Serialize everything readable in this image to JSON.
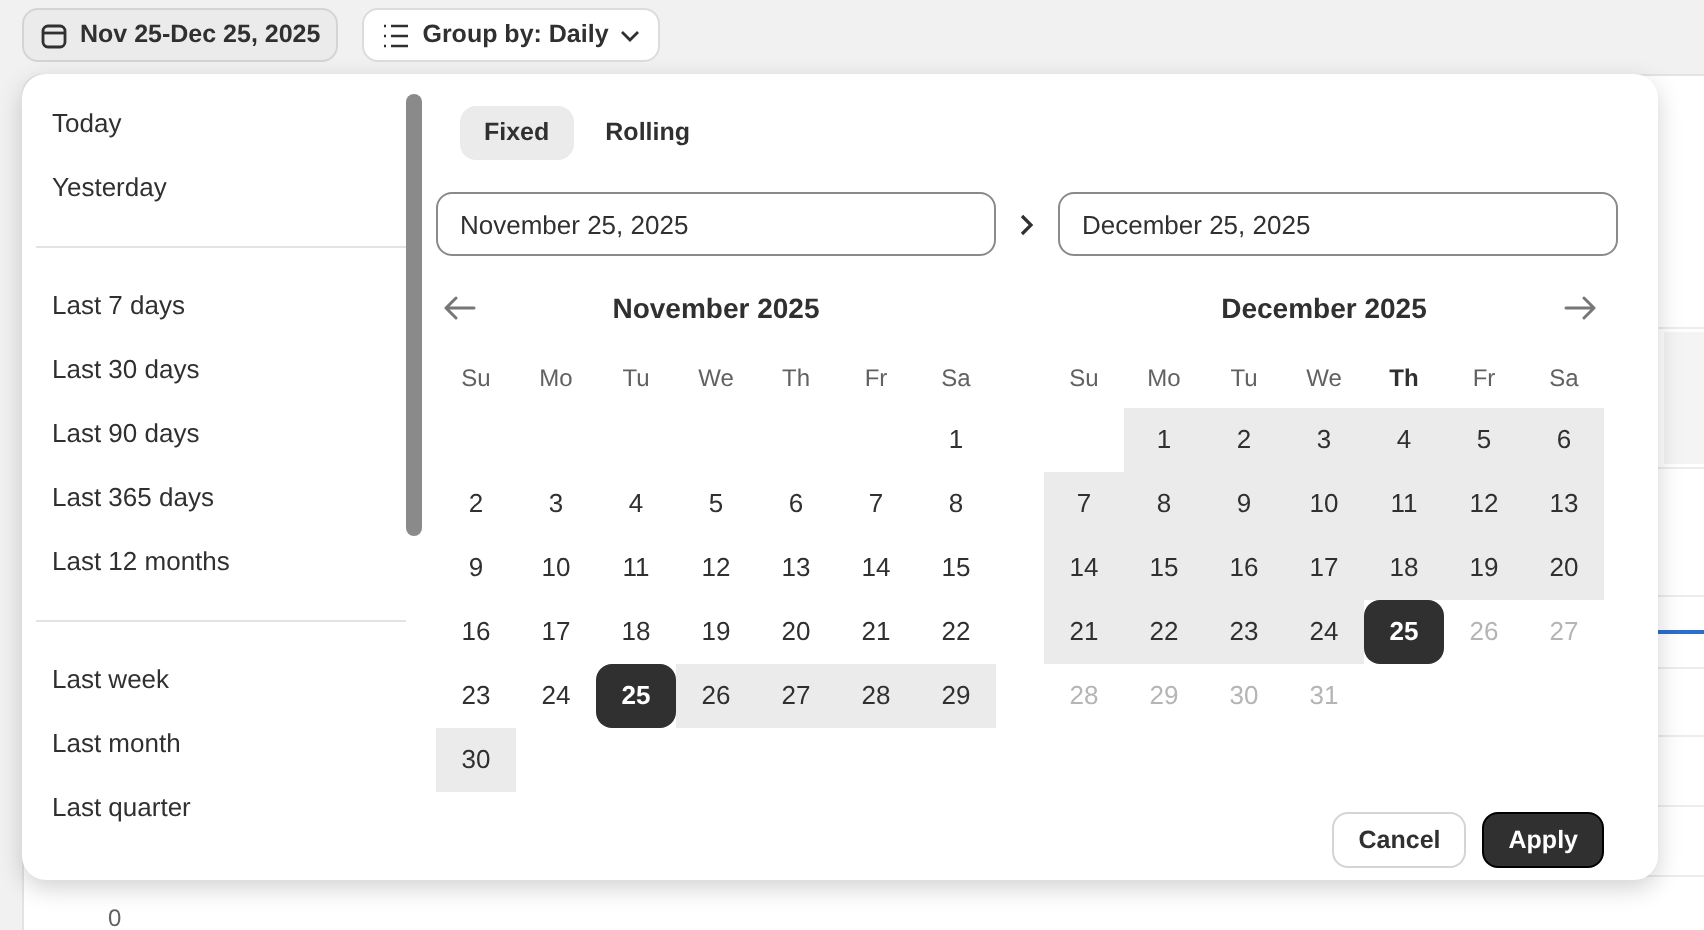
{
  "toolbar": {
    "date_range": "Nov 25-Dec 25, 2025",
    "group_by": "Group by: Daily"
  },
  "chart": {
    "axis_label": "0"
  },
  "presets": [
    [
      "Today",
      "Yesterday"
    ],
    [
      "Last 7 days",
      "Last 30 days",
      "Last 90 days",
      "Last 365 days",
      "Last 12 months"
    ],
    [
      "Last week",
      "Last month",
      "Last quarter"
    ]
  ],
  "tabs": [
    {
      "label": "Fixed",
      "selected": true
    },
    {
      "label": "Rolling",
      "selected": false
    }
  ],
  "start_field": {
    "value": "November 25, 2025"
  },
  "end_field": {
    "value": "December 25, 2025"
  },
  "months": [
    {
      "title": "November 2025",
      "prev_arrow": true,
      "next_arrow": false,
      "weekdays": [
        {
          "label": "Su",
          "today": false
        },
        {
          "label": "Mo",
          "today": false
        },
        {
          "label": "Tu",
          "today": false
        },
        {
          "label": "We",
          "today": false
        },
        {
          "label": "Th",
          "today": false
        },
        {
          "label": "Fr",
          "today": false
        },
        {
          "label": "Sa",
          "today": false
        }
      ],
      "weeks": [
        [
          {
            "kind": "blank"
          },
          {
            "kind": "blank"
          },
          {
            "kind": "blank"
          },
          {
            "kind": "blank"
          },
          {
            "kind": "blank"
          },
          {
            "kind": "blank"
          },
          {
            "kind": "day",
            "day": "1",
            "in_range": false,
            "selected": false,
            "disabled": false
          }
        ],
        [
          {
            "kind": "day",
            "day": "2",
            "in_range": false,
            "selected": false,
            "disabled": false
          },
          {
            "kind": "day",
            "day": "3",
            "in_range": false,
            "selected": false,
            "disabled": false
          },
          {
            "kind": "day",
            "day": "4",
            "in_range": false,
            "selected": false,
            "disabled": false
          },
          {
            "kind": "day",
            "day": "5",
            "in_range": false,
            "selected": false,
            "disabled": false
          },
          {
            "kind": "day",
            "day": "6",
            "in_range": false,
            "selected": false,
            "disabled": false
          },
          {
            "kind": "day",
            "day": "7",
            "in_range": false,
            "selected": false,
            "disabled": false
          },
          {
            "kind": "day",
            "day": "8",
            "in_range": false,
            "selected": false,
            "disabled": false
          }
        ],
        [
          {
            "kind": "day",
            "day": "9",
            "in_range": false,
            "selected": false,
            "disabled": false
          },
          {
            "kind": "day",
            "day": "10",
            "in_range": false,
            "selected": false,
            "disabled": false
          },
          {
            "kind": "day",
            "day": "11",
            "in_range": false,
            "selected": false,
            "disabled": false
          },
          {
            "kind": "day",
            "day": "12",
            "in_range": false,
            "selected": false,
            "disabled": false
          },
          {
            "kind": "day",
            "day": "13",
            "in_range": false,
            "selected": false,
            "disabled": false
          },
          {
            "kind": "day",
            "day": "14",
            "in_range": false,
            "selected": false,
            "disabled": false
          },
          {
            "kind": "day",
            "day": "15",
            "in_range": false,
            "selected": false,
            "disabled": false
          }
        ],
        [
          {
            "kind": "day",
            "day": "16",
            "in_range": false,
            "selected": false,
            "disabled": false
          },
          {
            "kind": "day",
            "day": "17",
            "in_range": false,
            "selected": false,
            "disabled": false
          },
          {
            "kind": "day",
            "day": "18",
            "in_range": false,
            "selected": false,
            "disabled": false
          },
          {
            "kind": "day",
            "day": "19",
            "in_range": false,
            "selected": false,
            "disabled": false
          },
          {
            "kind": "day",
            "day": "20",
            "in_range": false,
            "selected": false,
            "disabled": false
          },
          {
            "kind": "day",
            "day": "21",
            "in_range": false,
            "selected": false,
            "disabled": false
          },
          {
            "kind": "day",
            "day": "22",
            "in_range": false,
            "selected": false,
            "disabled": false
          }
        ],
        [
          {
            "kind": "day",
            "day": "23",
            "in_range": false,
            "selected": false,
            "disabled": false
          },
          {
            "kind": "day",
            "day": "24",
            "in_range": false,
            "selected": false,
            "disabled": false
          },
          {
            "kind": "day",
            "day": "25",
            "in_range": false,
            "selected": true,
            "disabled": false
          },
          {
            "kind": "day",
            "day": "26",
            "in_range": true,
            "selected": false,
            "disabled": false
          },
          {
            "kind": "day",
            "day": "27",
            "in_range": true,
            "selected": false,
            "disabled": false
          },
          {
            "kind": "day",
            "day": "28",
            "in_range": true,
            "selected": false,
            "disabled": false
          },
          {
            "kind": "day",
            "day": "29",
            "in_range": true,
            "selected": false,
            "disabled": false
          }
        ],
        [
          {
            "kind": "day",
            "day": "30",
            "in_range": true,
            "selected": false,
            "disabled": false
          },
          {
            "kind": "blank"
          },
          {
            "kind": "blank"
          },
          {
            "kind": "blank"
          },
          {
            "kind": "blank"
          },
          {
            "kind": "blank"
          },
          {
            "kind": "blank"
          }
        ]
      ]
    },
    {
      "title": "December 2025",
      "prev_arrow": false,
      "next_arrow": true,
      "weekdays": [
        {
          "label": "Su",
          "today": false
        },
        {
          "label": "Mo",
          "today": false
        },
        {
          "label": "Tu",
          "today": false
        },
        {
          "label": "We",
          "today": false
        },
        {
          "label": "Th",
          "today": true
        },
        {
          "label": "Fr",
          "today": false
        },
        {
          "label": "Sa",
          "today": false
        }
      ],
      "weeks": [
        [
          {
            "kind": "blank"
          },
          {
            "kind": "day",
            "day": "1",
            "in_range": true,
            "selected": false,
            "disabled": false
          },
          {
            "kind": "day",
            "day": "2",
            "in_range": true,
            "selected": false,
            "disabled": false
          },
          {
            "kind": "day",
            "day": "3",
            "in_range": true,
            "selected": false,
            "disabled": false
          },
          {
            "kind": "day",
            "day": "4",
            "in_range": true,
            "selected": false,
            "disabled": false
          },
          {
            "kind": "day",
            "day": "5",
            "in_range": true,
            "selected": false,
            "disabled": false
          },
          {
            "kind": "day",
            "day": "6",
            "in_range": true,
            "selected": false,
            "disabled": false
          }
        ],
        [
          {
            "kind": "day",
            "day": "7",
            "in_range": true,
            "selected": false,
            "disabled": false
          },
          {
            "kind": "day",
            "day": "8",
            "in_range": true,
            "selected": false,
            "disabled": false
          },
          {
            "kind": "day",
            "day": "9",
            "in_range": true,
            "selected": false,
            "disabled": false
          },
          {
            "kind": "day",
            "day": "10",
            "in_range": true,
            "selected": false,
            "disabled": false
          },
          {
            "kind": "day",
            "day": "11",
            "in_range": true,
            "selected": false,
            "disabled": false
          },
          {
            "kind": "day",
            "day": "12",
            "in_range": true,
            "selected": false,
            "disabled": false
          },
          {
            "kind": "day",
            "day": "13",
            "in_range": true,
            "selected": false,
            "disabled": false
          }
        ],
        [
          {
            "kind": "day",
            "day": "14",
            "in_range": true,
            "selected": false,
            "disabled": false
          },
          {
            "kind": "day",
            "day": "15",
            "in_range": true,
            "selected": false,
            "disabled": false
          },
          {
            "kind": "day",
            "day": "16",
            "in_range": true,
            "selected": false,
            "disabled": false
          },
          {
            "kind": "day",
            "day": "17",
            "in_range": true,
            "selected": false,
            "disabled": false
          },
          {
            "kind": "day",
            "day": "18",
            "in_range": true,
            "selected": false,
            "disabled": false
          },
          {
            "kind": "day",
            "day": "19",
            "in_range": true,
            "selected": false,
            "disabled": false
          },
          {
            "kind": "day",
            "day": "20",
            "in_range": true,
            "selected": false,
            "disabled": false
          }
        ],
        [
          {
            "kind": "day",
            "day": "21",
            "in_range": true,
            "selected": false,
            "disabled": false
          },
          {
            "kind": "day",
            "day": "22",
            "in_range": true,
            "selected": false,
            "disabled": false
          },
          {
            "kind": "day",
            "day": "23",
            "in_range": true,
            "selected": false,
            "disabled": false
          },
          {
            "kind": "day",
            "day": "24",
            "in_range": true,
            "selected": false,
            "disabled": false
          },
          {
            "kind": "day",
            "day": "25",
            "in_range": false,
            "selected": true,
            "disabled": false
          },
          {
            "kind": "day",
            "day": "26",
            "in_range": false,
            "selected": false,
            "disabled": true
          },
          {
            "kind": "day",
            "day": "27",
            "in_range": false,
            "selected": false,
            "disabled": true
          }
        ],
        [
          {
            "kind": "day",
            "day": "28",
            "in_range": false,
            "selected": false,
            "disabled": true
          },
          {
            "kind": "day",
            "day": "29",
            "in_range": false,
            "selected": false,
            "disabled": true
          },
          {
            "kind": "day",
            "day": "30",
            "in_range": false,
            "selected": false,
            "disabled": true
          },
          {
            "kind": "day",
            "day": "31",
            "in_range": false,
            "selected": false,
            "disabled": true
          },
          {
            "kind": "blank"
          },
          {
            "kind": "blank"
          },
          {
            "kind": "blank"
          }
        ]
      ]
    }
  ],
  "buttons": [
    {
      "label": "Cancel",
      "kind": "secondary"
    },
    {
      "label": "Apply",
      "kind": "primary"
    }
  ]
}
